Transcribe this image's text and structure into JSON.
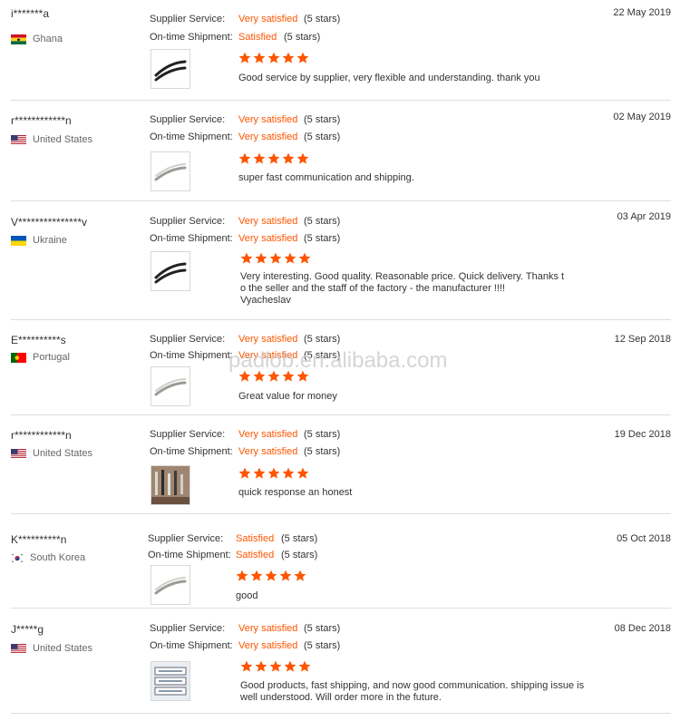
{
  "labels": {
    "supplier_service": "Supplier Service:",
    "on_time_shipment": "On-time Shipment:"
  },
  "watermark": "padlob.en.alibaba.com",
  "colors": {
    "accent": "#ff5500",
    "star": "#ff5500",
    "divider": "#dedede"
  },
  "reviews": [
    {
      "buyer": "i*******a",
      "country": "Ghana",
      "flag": "ghana-flag-icon",
      "supplier_service": "Very satisfied",
      "supplier_stars": "(5 stars)",
      "shipment": "Satisfied",
      "shipment_stars": "(5 stars)",
      "rating": 5,
      "product_image": "black-curved-handle-icon",
      "comment": "Good service by supplier, very flexible and understanding. thank you",
      "date": "22 May 2019"
    },
    {
      "buyer": "r************n",
      "country": "United States",
      "flag": "usa-flag-icon",
      "supplier_service": "Very satisfied",
      "supplier_stars": "(5 stars)",
      "shipment": "Very satisfied",
      "shipment_stars": "(5 stars)",
      "rating": 5,
      "product_image": "silver-curved-handle-icon",
      "comment": "super fast communication and shipping.",
      "date": "02 May 2019"
    },
    {
      "buyer": "V***************v",
      "country": "Ukraine",
      "flag": "ukraine-flag-icon",
      "supplier_service": "Very satisfied",
      "supplier_stars": "(5 stars)",
      "shipment": "Very satisfied",
      "shipment_stars": "(5 stars)",
      "rating": 5,
      "product_image": "black-curved-handle-icon",
      "comment_lines": [
        "Very interesting. Good quality. Reasonable price. Quick delivery. Thanks t",
        "o the seller and the staff of the factory - the manufacturer !!!!",
        "Vyacheslav"
      ],
      "date": "03 Apr 2019"
    },
    {
      "buyer": "E**********s",
      "country": "Portugal",
      "flag": "portugal-flag-icon",
      "supplier_service": "Very satisfied",
      "supplier_stars": "(5 stars)",
      "shipment": "Very satisfied",
      "shipment_stars": "(5 stars)",
      "rating": 5,
      "product_image": "silver-curved-handle-icon",
      "comment": "Great value for money",
      "date": "12 Sep 2018"
    },
    {
      "buyer": "r************n",
      "country": "United States",
      "flag": "usa-flag-icon",
      "supplier_service": "Very satisfied",
      "supplier_stars": "(5 stars)",
      "shipment": "Very satisfied",
      "shipment_stars": "(5 stars)",
      "rating": 5,
      "product_image": "handle-assortment-photo-icon",
      "comment": "quick response an honest",
      "date": "19 Dec 2018"
    },
    {
      "buyer": "K**********n",
      "country": "South Korea",
      "flag": "south-korea-flag-icon",
      "supplier_service": "Satisfied",
      "supplier_stars": "(5 stars)",
      "shipment": "Satisfied",
      "shipment_stars": "(5 stars)",
      "rating": 5,
      "product_image": "silver-curved-handle-icon",
      "comment": "good",
      "date": "05 Oct 2018"
    },
    {
      "buyer": "J*****g",
      "country": "United States",
      "flag": "usa-flag-icon",
      "supplier_service": "Very satisfied",
      "supplier_stars": "(5 stars)",
      "shipment": "Very satisfied",
      "shipment_stars": "(5 stars)",
      "rating": 5,
      "product_image": "boxed-handles-photo-icon",
      "comment_lines": [
        "Good products, fast shipping, and now good communication. shipping issue is",
        "well understood.  Will order more in the future."
      ],
      "date": "08 Dec 2018"
    }
  ]
}
